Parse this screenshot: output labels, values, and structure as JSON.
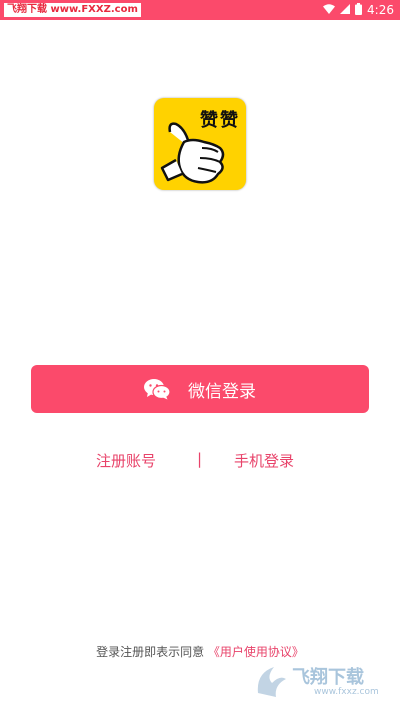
{
  "status_bar": {
    "watermark": "飞翔下载 www.FXXZ.com",
    "time": "4:26",
    "background": "#fb4a6b"
  },
  "logo": {
    "text": "赞赞",
    "icon": "thumbs-up-icon",
    "background": "#ffd200"
  },
  "login": {
    "wechat_button_label": "微信登录",
    "icon": "wechat-icon",
    "accent": "#fb4a6b"
  },
  "links": {
    "register": "注册账号",
    "separator": "|",
    "phone_login": "手机登录"
  },
  "agreement": {
    "prefix": "登录注册即表示同意",
    "link_text": "《用户使用协议》"
  },
  "corner_watermark": {
    "title": "飞翔下载",
    "url": "www.fxxz.com"
  }
}
